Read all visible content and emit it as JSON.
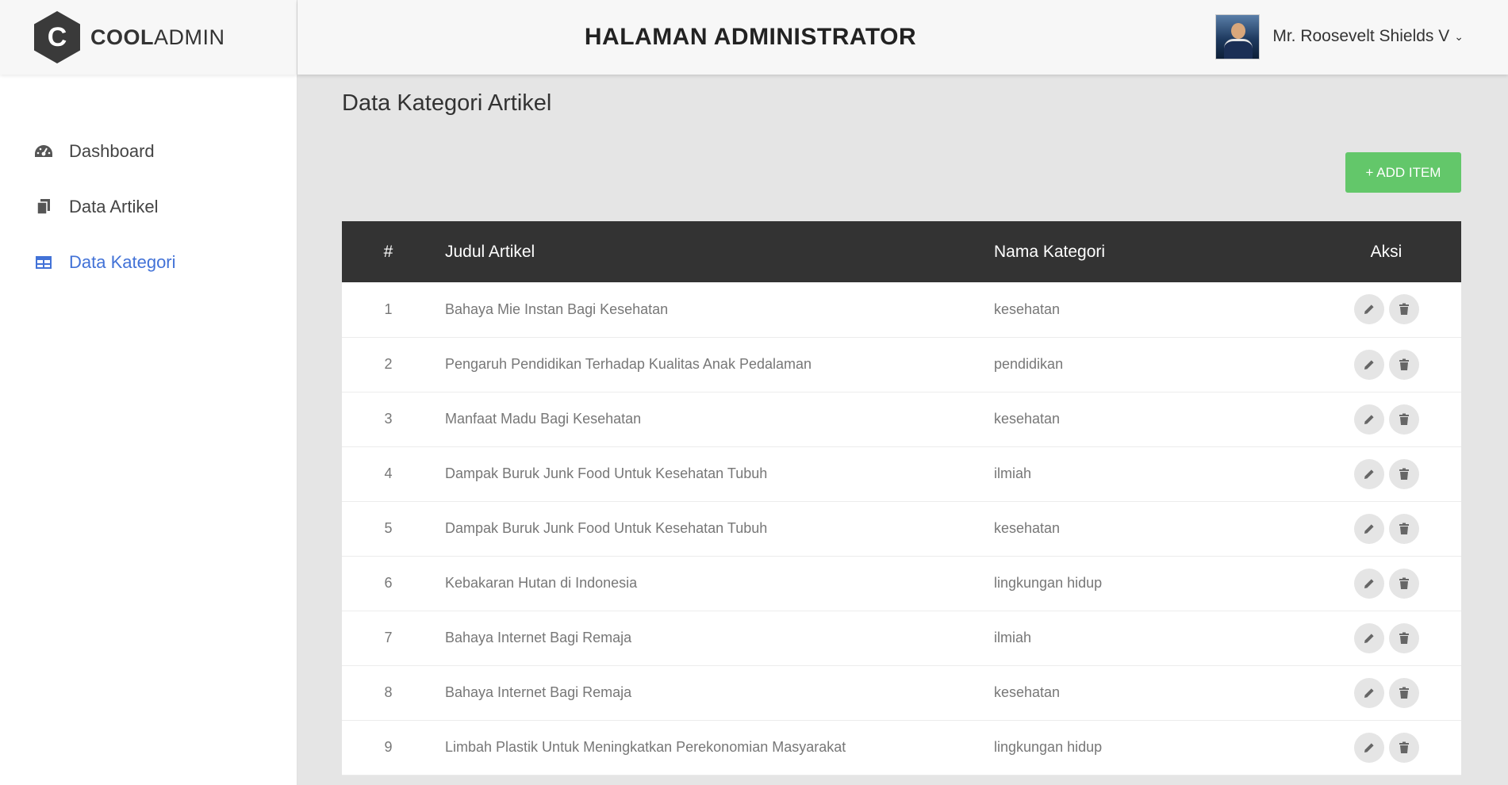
{
  "brand": {
    "bold": "COOL",
    "light": "ADMIN",
    "mark": "C"
  },
  "header": {
    "title": "HALAMAN ADMINISTRATOR",
    "user_name": "Mr. Roosevelt Shields V"
  },
  "sidebar": {
    "items": [
      {
        "label": "Dashboard",
        "icon": "dashboard-gauge-icon",
        "active": false
      },
      {
        "label": "Data Artikel",
        "icon": "copy-files-icon",
        "active": false
      },
      {
        "label": "Data Kategori",
        "icon": "table-icon",
        "active": true
      }
    ]
  },
  "main": {
    "page_title": "Data Kategori Artikel",
    "add_button": "+ ADD ITEM"
  },
  "table": {
    "headers": [
      "#",
      "Judul Artikel",
      "Nama Kategori",
      "Aksi"
    ],
    "rows": [
      {
        "no": "1",
        "judul": "Bahaya Mie Instan Bagi Kesehatan",
        "kategori": "kesehatan"
      },
      {
        "no": "2",
        "judul": "Pengaruh Pendidikan Terhadap Kualitas Anak Pedalaman",
        "kategori": "pendidikan"
      },
      {
        "no": "3",
        "judul": "Manfaat Madu Bagi Kesehatan",
        "kategori": "kesehatan"
      },
      {
        "no": "4",
        "judul": "Dampak Buruk Junk Food Untuk Kesehatan Tubuh",
        "kategori": "ilmiah"
      },
      {
        "no": "5",
        "judul": "Dampak Buruk Junk Food Untuk Kesehatan Tubuh",
        "kategori": "kesehatan"
      },
      {
        "no": "6",
        "judul": "Kebakaran Hutan di Indonesia",
        "kategori": "lingkungan hidup"
      },
      {
        "no": "7",
        "judul": "Bahaya Internet Bagi Remaja",
        "kategori": "ilmiah"
      },
      {
        "no": "8",
        "judul": "Bahaya Internet Bagi Remaja",
        "kategori": "kesehatan"
      },
      {
        "no": "9",
        "judul": "Limbah Plastik Untuk Meningkatkan Perekonomian Masyarakat",
        "kategori": "lingkungan hidup"
      }
    ],
    "row_actions": [
      "edit-pencil-icon",
      "delete-trash-icon"
    ]
  },
  "colors": {
    "accent": "#4272d7",
    "add_button": "#63c76a",
    "table_header": "#333333"
  }
}
